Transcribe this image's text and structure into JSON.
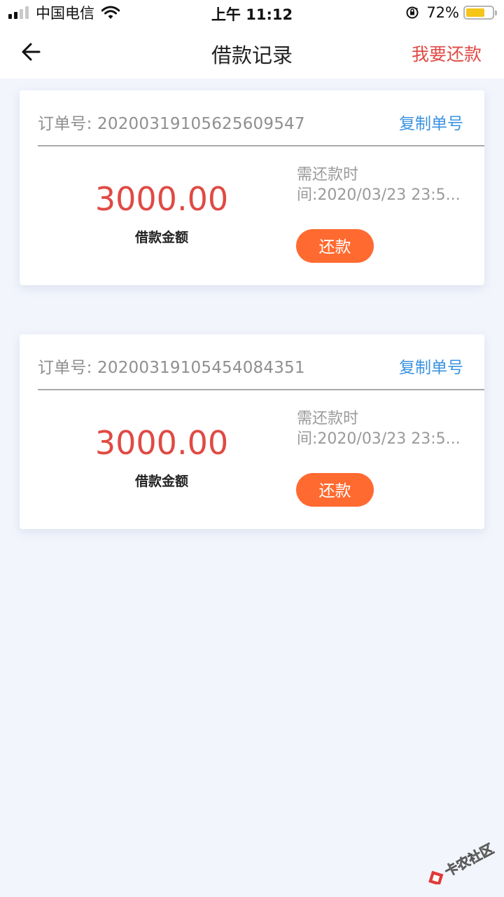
{
  "status_bar": {
    "carrier": "中国电信",
    "time": "上午 11:12",
    "battery": "72%",
    "battery_level": 0.72
  },
  "nav": {
    "title": "借款记录",
    "action": "我要还款"
  },
  "records": [
    {
      "order_label": "订单号: 20200319105625609547",
      "copy_label": "复制单号",
      "amount": "3000.00",
      "amount_label": "借款金额",
      "due_line1": "需还款时",
      "due_line2": "间:2020/03/23 23:5...",
      "repay_label": "还款"
    },
    {
      "order_label": "订单号: 20200319105454084351",
      "copy_label": "复制单号",
      "amount": "3000.00",
      "amount_label": "借款金额",
      "due_line1": "需还款时",
      "due_line2": "间:2020/03/23 23:5...",
      "repay_label": "还款"
    }
  ],
  "watermark": {
    "text": "卡农社区"
  },
  "colors": {
    "accent_red": "#e04a44",
    "link_blue": "#3a93e0",
    "button_orange": "#ff6a30",
    "page_bg": "#f2f5fc"
  }
}
